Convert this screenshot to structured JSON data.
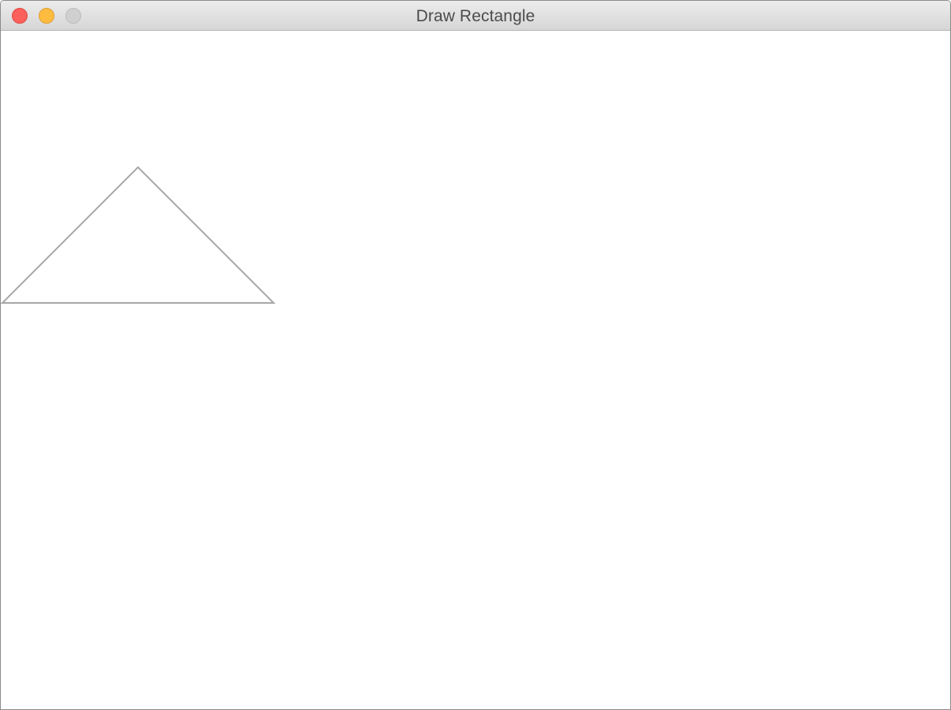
{
  "window": {
    "title": "Draw Rectangle",
    "controls": {
      "close": "close-button",
      "minimize": "minimize-button",
      "zoom": "zoom-button"
    }
  },
  "colors": {
    "close": "#fc605c",
    "minimize": "#fdbc40",
    "zoom": "#d0d0d0",
    "shape_stroke": "#a6a6a6"
  },
  "drawing": {
    "shapes": [
      {
        "type": "triangle"
      }
    ]
  }
}
